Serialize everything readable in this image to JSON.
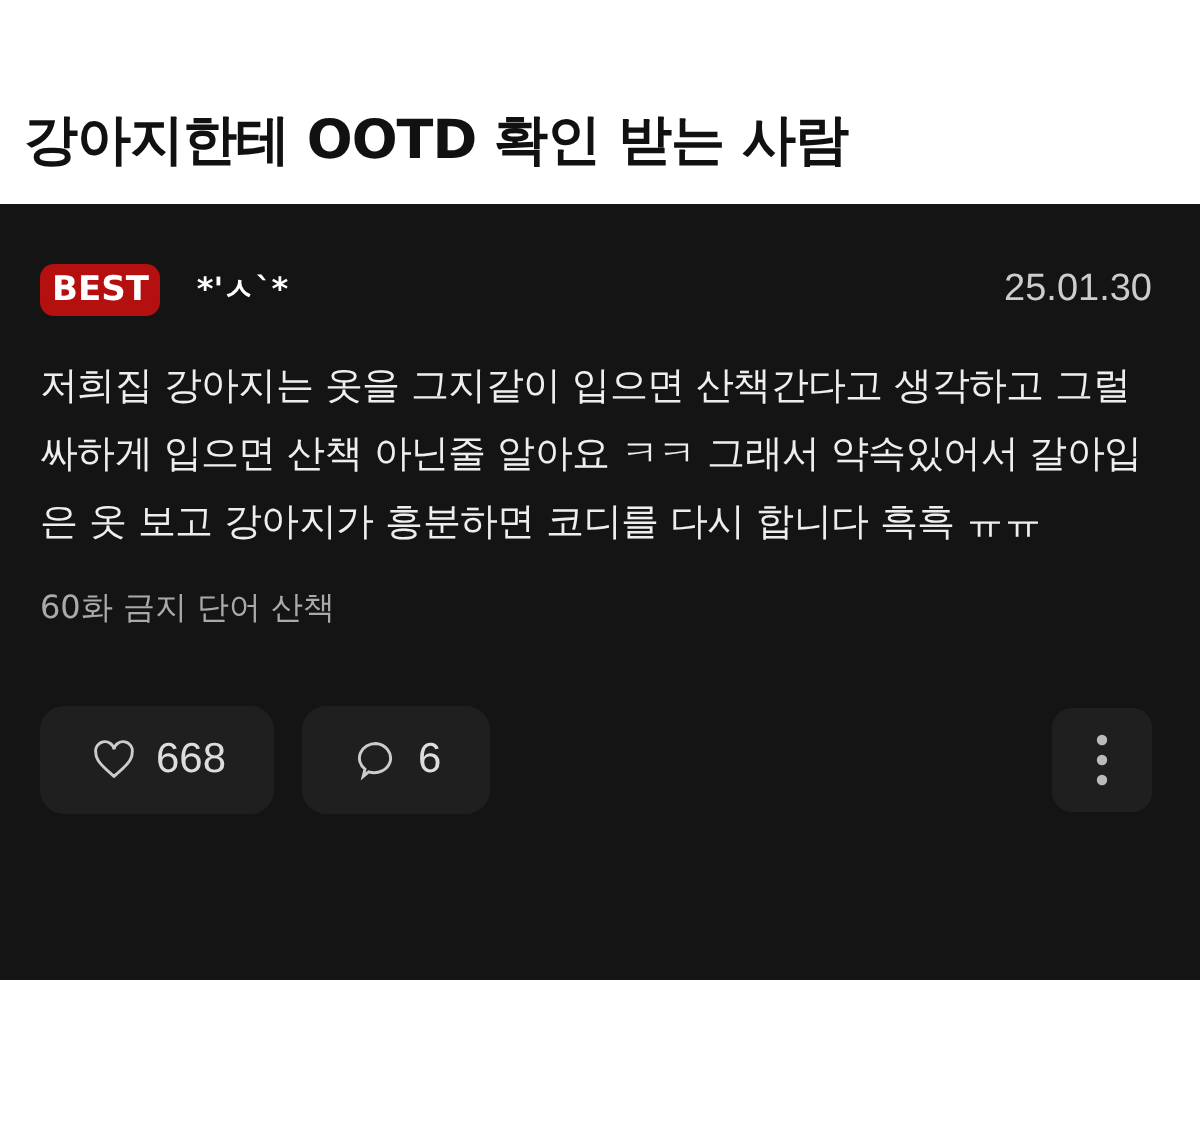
{
  "title": "강아지한테 OOTD 확인 받는 사람",
  "post": {
    "badge": "BEST",
    "author": "*'ㅅ`*",
    "date": "25.01.30",
    "body": "저희집 강아지는 옷을 그지같이 입으면 산책간다고 생각하고 그럴싸하게 입으면 산책 아닌줄 알아요 ㅋㅋ 그래서 약속있어서 갈아입은 옷 보고 강아지가 흥분하면 코디를 다시 합니다 흑흑 ㅠㅠ",
    "tag": "60화 금지 단어 산책",
    "actions": [
      {
        "kind": "like",
        "count": "668"
      },
      {
        "kind": "comment",
        "count": "6"
      }
    ]
  }
}
